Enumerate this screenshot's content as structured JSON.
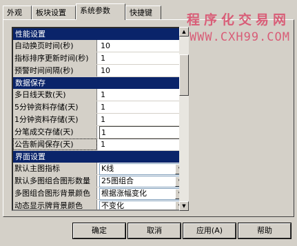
{
  "tabs": [
    {
      "label": "外观",
      "active": false
    },
    {
      "label": "板块设置",
      "active": false
    },
    {
      "label": "系统参数",
      "active": true
    },
    {
      "label": "快捷键",
      "active": false
    }
  ],
  "watermark": {
    "title": "程序化交易网",
    "url": "WWW.CXH99.COM"
  },
  "sections": {
    "perf": "性能设置",
    "data": "数据保存",
    "ui": "界面设置"
  },
  "perf_rows": [
    {
      "label": "自动换页时间(秒)",
      "value": "10"
    },
    {
      "label": "指标排序更新时间(秒)",
      "value": "1"
    },
    {
      "label": "预警时间间隔(秒)",
      "value": "10"
    }
  ],
  "data_rows": [
    {
      "label": "多日线天数(天)",
      "value": "1"
    },
    {
      "label": "5分钟资料存储(天)",
      "value": "1"
    },
    {
      "label": "1分钟资料存储(天)",
      "value": "1"
    },
    {
      "label": "分笔成交存储(天)",
      "value": "1"
    },
    {
      "label": "公告新闻保存(天)",
      "value": "1"
    }
  ],
  "ui_rows": [
    {
      "label": "默认主图指标",
      "value": "K线"
    },
    {
      "label": "默认多图组合图形数量",
      "value": "25图组合"
    },
    {
      "label": "多图组合图形背景颜色",
      "value": "根据涨幅变化"
    },
    {
      "label": "动态显示牌背景颜色",
      "value": "不变化"
    }
  ],
  "buttons": {
    "ok": "确定",
    "cancel": "取消",
    "apply": "应用(A)",
    "help": "帮助"
  }
}
